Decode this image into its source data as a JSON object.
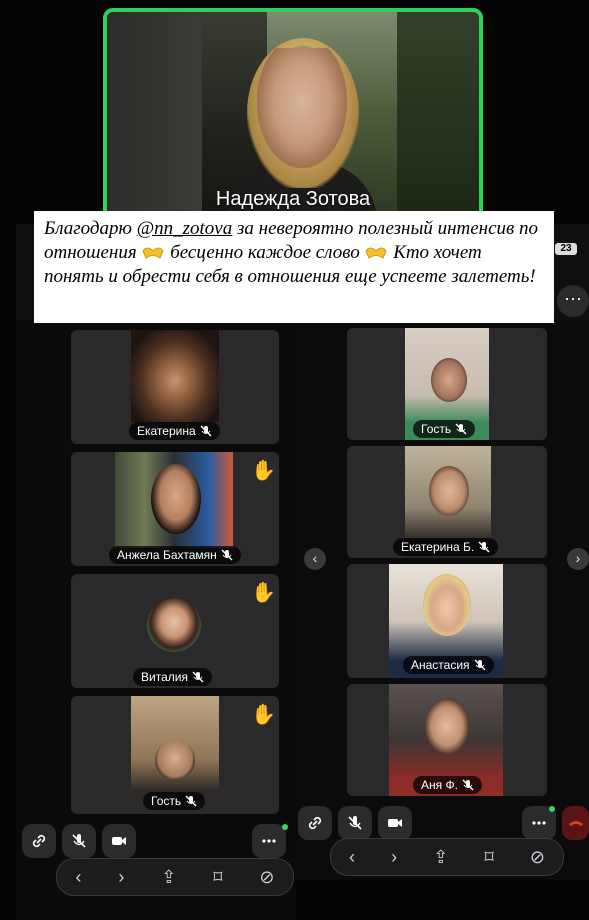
{
  "host": {
    "name": "Надежда Зотова"
  },
  "caption": {
    "part1": "Благодарю ",
    "mention": "@nn_zotova",
    "part2": " за невероятно полезный интенсив по отношения ",
    "part3": " бесценно каждое слово ",
    "part4": " Кто хочет понять и обрести себя в отношения еще успеете залететь!"
  },
  "badge": "23",
  "left_grid": {
    "participants": [
      {
        "name": "Екатерина",
        "muted": true,
        "hand_raised": false
      },
      {
        "name": "Анжела Бахтамян",
        "muted": true,
        "hand_raised": true
      },
      {
        "name": "Виталия",
        "muted": true,
        "hand_raised": true
      },
      {
        "name": "Гость",
        "muted": true,
        "hand_raised": true
      }
    ]
  },
  "right_grid": {
    "participants": [
      {
        "name": "Гость",
        "muted": true
      },
      {
        "name": "Екатерина Б.",
        "muted": true
      },
      {
        "name": "Анастасия",
        "muted": true
      },
      {
        "name": "Аня Ф.",
        "muted": true
      }
    ]
  },
  "controls": [
    "link-icon",
    "mic-off-icon",
    "camera-icon",
    "more-icon",
    "hang-up-icon"
  ],
  "browser_nav": [
    "back-icon",
    "forward-icon",
    "share-icon",
    "bookmark-icon",
    "compass-icon"
  ],
  "colors": {
    "active_speaker": "#2ed15c",
    "background": "#050505",
    "tile": "#2a2a2c",
    "hangup": "#e53935"
  }
}
